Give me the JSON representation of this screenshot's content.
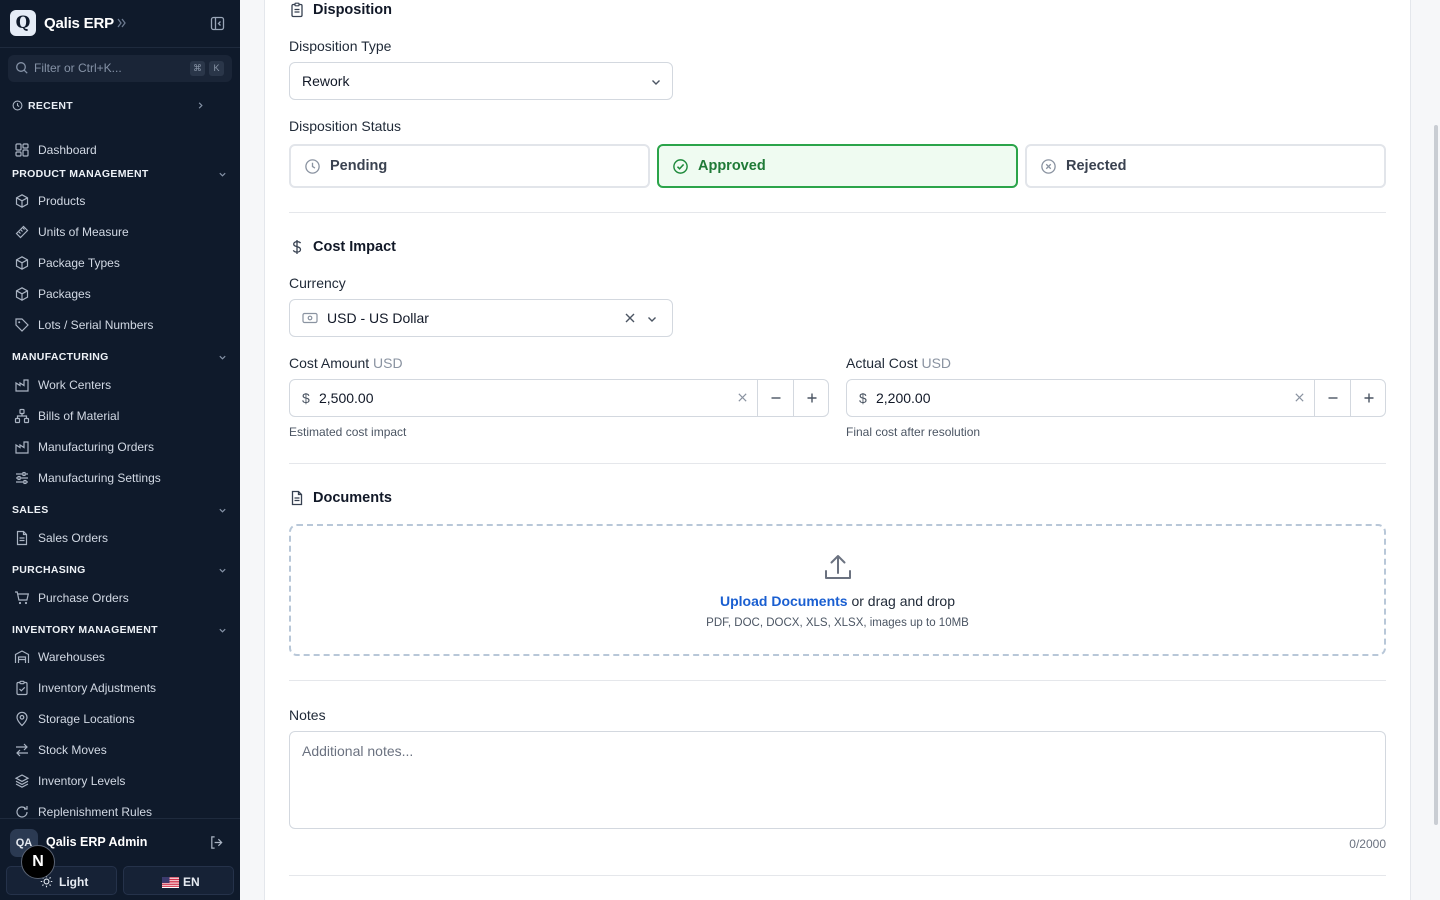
{
  "app": {
    "name": "Qalis ERP",
    "logo_letter": "Q"
  },
  "sidebar": {
    "filter_placeholder": "Filter or Ctrl+K...",
    "shortcut_keys": [
      "⌘",
      "K"
    ],
    "recent_label": "RECENT",
    "dashboard": "Dashboard",
    "sections": [
      {
        "title": "PRODUCT MANAGEMENT",
        "items": [
          "Products",
          "Units of Measure",
          "Package Types",
          "Packages",
          "Lots / Serial Numbers"
        ]
      },
      {
        "title": "MANUFACTURING",
        "items": [
          "Work Centers",
          "Bills of Material",
          "Manufacturing Orders",
          "Manufacturing Settings"
        ]
      },
      {
        "title": "SALES",
        "items": [
          "Sales Orders"
        ]
      },
      {
        "title": "PURCHASING",
        "items": [
          "Purchase Orders"
        ]
      },
      {
        "title": "INVENTORY MANAGEMENT",
        "items": [
          "Warehouses",
          "Inventory Adjustments",
          "Storage Locations",
          "Stock Moves",
          "Inventory Levels",
          "Replenishment Rules"
        ]
      }
    ],
    "user": {
      "initials": "QA",
      "name": "Qalis ERP Admin"
    },
    "theme_label": "Light",
    "language_label": "EN",
    "floating_badge": "N"
  },
  "disposition": {
    "section_title": "Disposition",
    "type_label": "Disposition Type",
    "type_value": "Rework",
    "status_label": "Disposition Status",
    "statuses": [
      {
        "label": "Pending",
        "active": false
      },
      {
        "label": "Approved",
        "active": true
      },
      {
        "label": "Rejected",
        "active": false
      }
    ]
  },
  "cost_impact": {
    "section_title": "Cost Impact",
    "currency_label": "Currency",
    "currency_value": "USD - US Dollar",
    "cost_amount": {
      "label": "Cost Amount",
      "unit": "USD",
      "symbol": "$",
      "value": "2,500.00",
      "hint": "Estimated cost impact"
    },
    "actual_cost": {
      "label": "Actual Cost",
      "unit": "USD",
      "symbol": "$",
      "value": "2,200.00",
      "hint": "Final cost after resolution"
    }
  },
  "documents": {
    "section_title": "Documents",
    "upload_link": "Upload Documents",
    "upload_suffix": " or drag and drop",
    "formats": "PDF, DOC, DOCX, XLS, XLSX, images up to 10MB"
  },
  "notes": {
    "label": "Notes",
    "placeholder": "Additional notes...",
    "counter": "0/2000"
  },
  "colors": {
    "sidebar_bg": "#0f1a2b",
    "approved_border": "#2ba44a",
    "approved_bg": "#effbf1",
    "link_blue": "#1a5fd1"
  }
}
